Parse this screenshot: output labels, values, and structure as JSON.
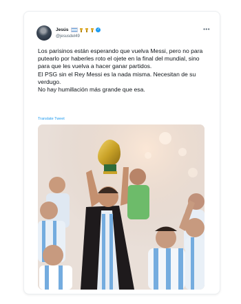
{
  "tweet": {
    "display_name": "Jesús",
    "handle": "@jesusdel49",
    "more_label": "•••",
    "verified_mark": "✓",
    "name_badges": [
      "argentina-flag-emoji",
      "trophy-emoji",
      "trophy-emoji",
      "trophy-emoji",
      "verified-badge"
    ],
    "paragraphs": [
      "Los parisinos están esperando que vuelva Messi, pero no para putearlo por haberles roto el ojete en la final del mundial, sino para que les vuelva a hacer ganar partidos.",
      "El PSG sin el Rey Messi es la nada misma. Necesitan de su verdugo.",
      "No hay humillación más grande que esa."
    ],
    "translate_label": "Translate Tweet"
  },
  "colors": {
    "link": "#1d9bf0",
    "text": "#0f1419",
    "secondary": "#536471",
    "trophy_gold": "#c9a227",
    "jersey_blue": "#74acdf"
  }
}
